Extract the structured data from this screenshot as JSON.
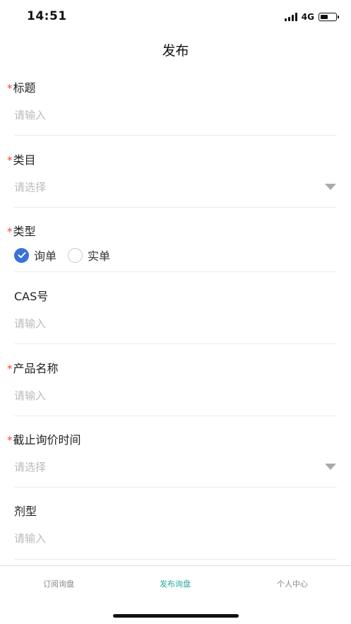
{
  "status_bar": {
    "time": "14:51",
    "network": "4G",
    "battery_level": 0.5
  },
  "nav": {
    "title": "发布"
  },
  "form": {
    "required_mark": "*",
    "title_field": {
      "label": "标题",
      "placeholder": "请输入"
    },
    "category_field": {
      "label": "类目",
      "placeholder": "请选择"
    },
    "type_field": {
      "label": "类型",
      "options": [
        {
          "label": "询单",
          "checked": true
        },
        {
          "label": "实单",
          "checked": false
        }
      ]
    },
    "cas_field": {
      "label": "CAS号",
      "placeholder": "请输入"
    },
    "product_name_field": {
      "label": "产品名称",
      "placeholder": "请输入"
    },
    "deadline_field": {
      "label": "截止询价时间",
      "placeholder": "请选择"
    },
    "dosage_form_field": {
      "label": "剂型",
      "placeholder": "请输入"
    }
  },
  "tabbar": {
    "tabs": [
      {
        "label": "订阅询盘",
        "active": false
      },
      {
        "label": "发布询盘",
        "active": true
      },
      {
        "label": "个人中心",
        "active": false
      }
    ],
    "active_color": "#28a79b"
  },
  "colors": {
    "required": "#e64a3b",
    "radio_checked": "#3a72d8",
    "placeholder": "#bbbbbb"
  }
}
